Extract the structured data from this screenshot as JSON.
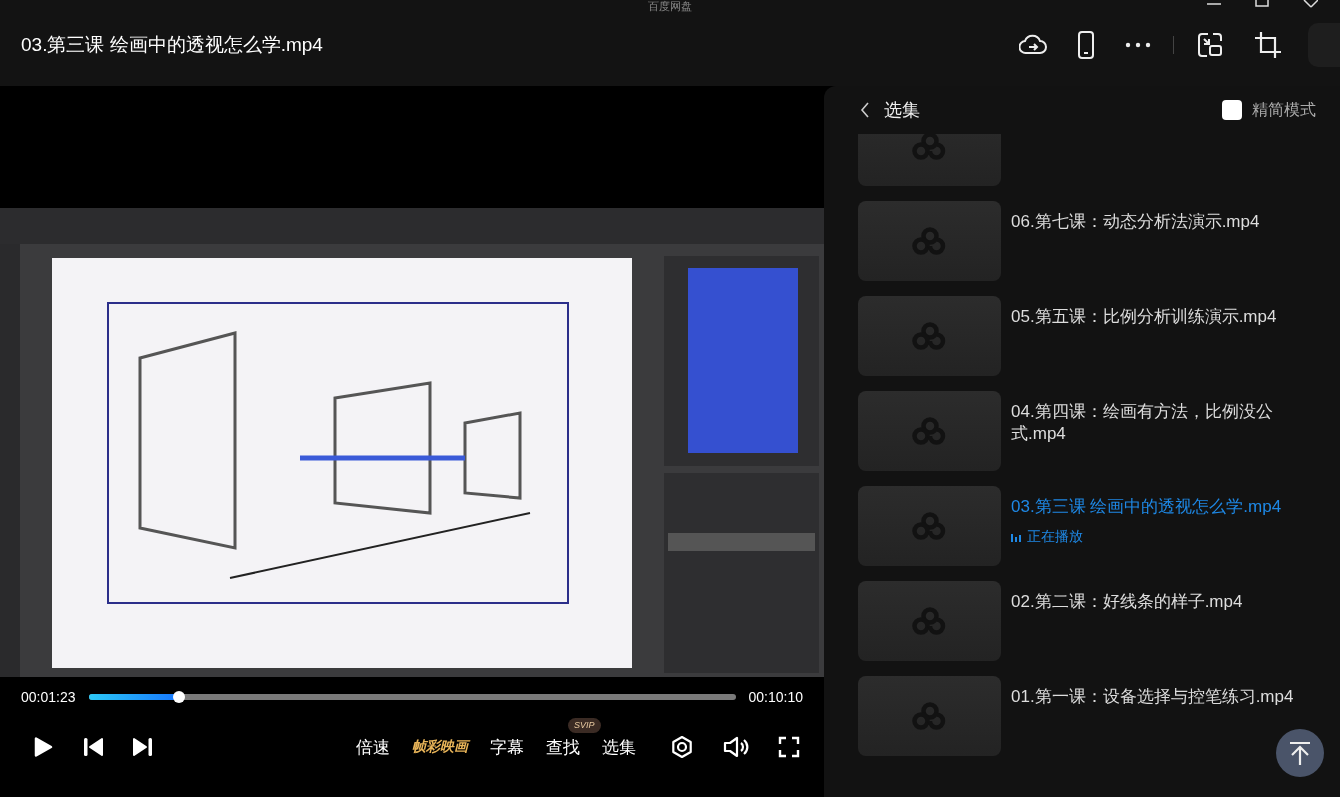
{
  "app_title": "百度网盘",
  "title": "03.第三课 绘画中的透视怎么学.mp4",
  "player": {
    "current_time": "00:01:23",
    "duration": "00:10:10",
    "level": 0.14,
    "playing": false,
    "controls": [
      {
        "kind": "text",
        "label": "倍速"
      },
      {
        "kind": "brand",
        "label": "帧彩映画"
      },
      {
        "kind": "text",
        "label": "字幕"
      },
      {
        "kind": "text",
        "label": "查找",
        "badge": "SVIP"
      },
      {
        "kind": "text",
        "label": "选集"
      }
    ]
  },
  "sidebar": {
    "title": "选集",
    "simple_mode": {
      "label": "精简模式",
      "checked": false
    },
    "items": [
      {
        "kind": "clipped"
      },
      {
        "kind": "episode",
        "title": "06.第七课：动态分析法演示.mp4",
        "selected": false
      },
      {
        "kind": "episode",
        "title": "05.第五课：比例分析训练演示.mp4",
        "selected": false
      },
      {
        "kind": "episode",
        "title": "04.第四课：绘画有方法，比例没公式.mp4",
        "selected": false
      },
      {
        "kind": "episode",
        "title": "03.第三课 绘画中的透视怎么学.mp4",
        "selected": true,
        "status": "正在播放"
      },
      {
        "kind": "episode",
        "title": "02.第二课：好线条的样子.mp4",
        "selected": false
      },
      {
        "kind": "episode",
        "title": "01.第一课：设备选择与控笔练习.mp4",
        "selected": false
      }
    ]
  }
}
